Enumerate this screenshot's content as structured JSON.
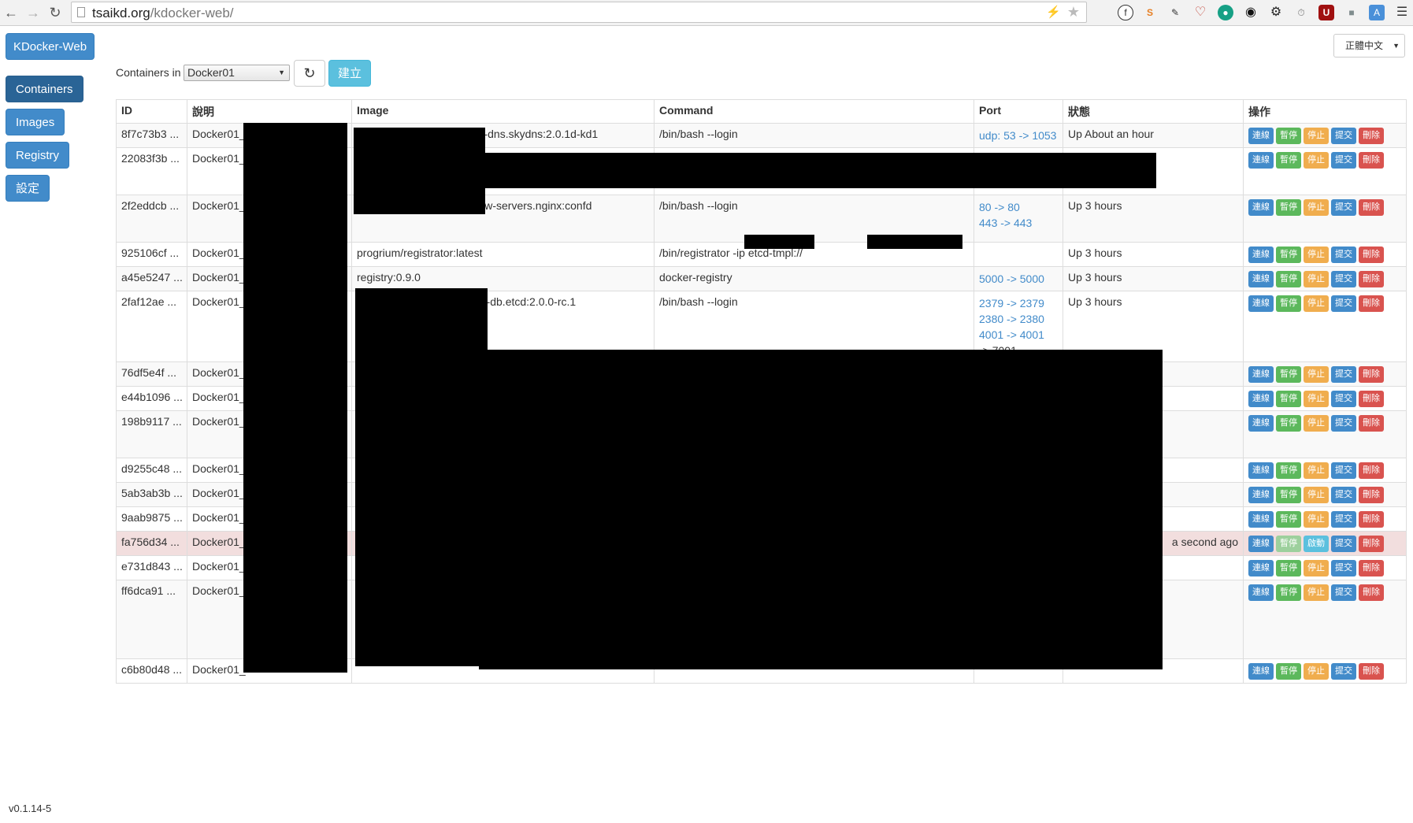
{
  "browser": {
    "url_host": "tsaikd.org",
    "url_path": "/kdocker-web/"
  },
  "app": {
    "brand": "KDocker-Web",
    "nav": [
      "Containers",
      "Images",
      "Registry",
      "設定"
    ],
    "language": "正體中文",
    "filter_label": "Containers in",
    "host_select": "Docker01",
    "create_label": "建立",
    "version": "v0.1.14-5"
  },
  "table": {
    "headers": [
      "ID",
      "說明",
      "Image",
      "Command",
      "Port",
      "狀態",
      "操作"
    ],
    "rows": [
      {
        "id": "8f7c73b3 ...",
        "desc": "Docker01_",
        "image": "net-dns.skydns:2.0.1d-kd1",
        "command": "/bin/bash --login",
        "ports": [
          "udp: 53 -> 1053"
        ],
        "status": "Up About an hour",
        "actions": [
          "連線",
          "暫停",
          "停止",
          "提交",
          "刪除"
        ]
      },
      {
        "id": "22083f3b ...",
        "desc": "Docker01_",
        "image": "",
        "command": "",
        "ports": [],
        "status": "",
        "actions": [
          "連線",
          "暫停",
          "停止",
          "提交",
          "刪除"
        ]
      },
      {
        "id": "2f2eddcb ...",
        "desc": "Docker01_",
        "image": "www-servers.nginx:confd",
        "command": "/bin/bash --login",
        "ports": [
          "80 -> 80",
          "443 -> 443"
        ],
        "status": "Up 3 hours",
        "actions": [
          "連線",
          "暫停",
          "停止",
          "提交",
          "刪除"
        ]
      },
      {
        "id": "925106cf ...",
        "desc": "Docker01_",
        "image": "progrium/registrator:latest",
        "command": "/bin/registrator -ip                    etcd-tmpl://",
        "ports": [],
        "status": "Up 3 hours",
        "actions": [
          "連線",
          "暫停",
          "停止",
          "提交",
          "刪除"
        ]
      },
      {
        "id": "a45e5247 ...",
        "desc": "Docker01_",
        "image": "registry:0.9.0",
        "command": "docker-registry",
        "ports": [
          "5000 -> 5000"
        ],
        "status": "Up 3 hours",
        "actions": [
          "連線",
          "暫停",
          "停止",
          "提交",
          "刪除"
        ]
      },
      {
        "id": "2faf12ae ...",
        "desc": "Docker01_",
        "image": "dev-db.etcd:2.0.0-rc.1",
        "command": "/bin/bash --login",
        "ports": [
          "2379 -> 2379",
          "2380 -> 2380",
          "4001 -> 4001",
          "-> 7001"
        ],
        "status": "Up 3 hours",
        "actions": [
          "連線",
          "暫停",
          "停止",
          "提交",
          "刪除"
        ]
      },
      {
        "id": "76df5e4f ...",
        "desc": "Docker01_",
        "image": "",
        "command": "",
        "ports": [],
        "status": "",
        "actions": [
          "連線",
          "暫停",
          "停止",
          "提交",
          "刪除"
        ]
      },
      {
        "id": "e44b1096 ...",
        "desc": "Docker01_",
        "image": "",
        "command": "",
        "ports": [],
        "status": "",
        "actions": [
          "連線",
          "暫停",
          "停止",
          "提交",
          "刪除"
        ]
      },
      {
        "id": "198b9117 ...",
        "desc": "Docker01_",
        "image": "",
        "command": "",
        "ports": [],
        "status": "",
        "actions": [
          "連線",
          "暫停",
          "停止",
          "提交",
          "刪除"
        ]
      },
      {
        "id": "d9255c48 ...",
        "desc": "Docker01_",
        "image": "",
        "command": "",
        "ports": [],
        "status": "",
        "actions": [
          "連線",
          "暫停",
          "停止",
          "提交",
          "刪除"
        ]
      },
      {
        "id": "5ab3ab3b ...",
        "desc": "Docker01_",
        "image": "",
        "command": "",
        "ports": [],
        "status": "",
        "actions": [
          "連線",
          "暫停",
          "停止",
          "提交",
          "刪除"
        ]
      },
      {
        "id": "9aab9875 ...",
        "desc": "Docker01_",
        "image": "",
        "command": "",
        "ports": [],
        "status": "",
        "actions": [
          "連線",
          "暫停",
          "停止",
          "提交",
          "刪除"
        ]
      },
      {
        "id": "fa756d34 ...",
        "desc": "Docker01_",
        "image": "",
        "command": "",
        "ports": [],
        "status": "a second ago",
        "stopped": true,
        "actions": [
          "連線",
          "暫停",
          "啟動",
          "提交",
          "刪除"
        ]
      },
      {
        "id": "e731d843 ...",
        "desc": "Docker01_",
        "image": "",
        "command": "",
        "ports": [],
        "status": "",
        "actions": [
          "連線",
          "暫停",
          "停止",
          "提交",
          "刪除"
        ]
      },
      {
        "id": "ff6dca91 ...",
        "desc": "Docker01_",
        "image": "",
        "command": "",
        "ports": [],
        "status": "",
        "actions": [
          "連線",
          "暫停",
          "停止",
          "提交",
          "刪除"
        ]
      },
      {
        "id": "c6b80d48 ...",
        "desc": "Docker01_",
        "image": "",
        "command": "",
        "ports": [],
        "status": "",
        "actions": [
          "連線",
          "暫停",
          "停止",
          "提交",
          "刪除"
        ]
      }
    ]
  }
}
